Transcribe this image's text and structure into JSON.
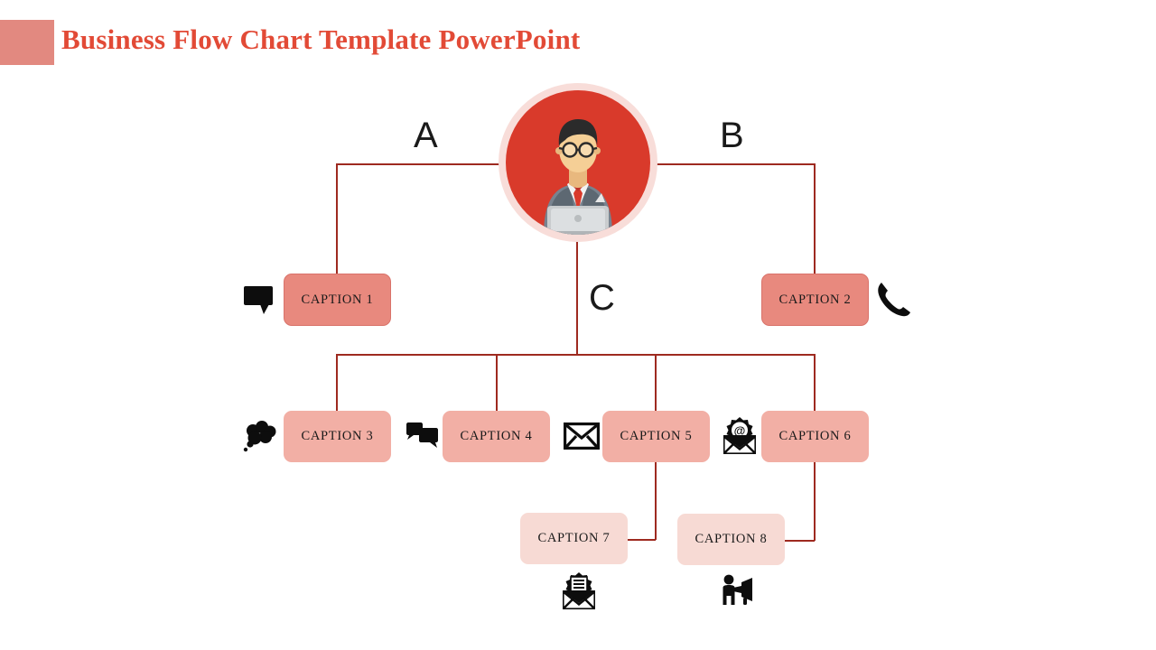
{
  "header": {
    "title": "Business Flow Chart Template PowerPoint",
    "swatch_color": "#e28980",
    "title_color": "#e24a36"
  },
  "theme": {
    "line_color": "#9e2a20",
    "box_dark": "#e8897e",
    "box_mid": "#f2afa5",
    "box_light": "#f7dad4",
    "avatar_ring": "#f8ddd9",
    "avatar_disc": "#d93a2b",
    "label_color": "#1a1a1a"
  },
  "avatar": {
    "name": "businessman-with-laptop-avatar",
    "description": "Illustrated businessman wearing glasses, gray suit and red tie working on a laptop"
  },
  "branch_labels": [
    {
      "id": "a",
      "text": "A"
    },
    {
      "id": "b",
      "text": "B"
    },
    {
      "id": "c",
      "text": "C"
    }
  ],
  "nodes": [
    {
      "id": "caption-1",
      "label": "CAPTION 1",
      "tone": "dark",
      "icon": "speech-bubble-icon",
      "icon_side": "left"
    },
    {
      "id": "caption-2",
      "label": "CAPTION 2",
      "tone": "dark",
      "icon": "phone-icon",
      "icon_side": "right"
    },
    {
      "id": "caption-3",
      "label": "CAPTION 3",
      "tone": "mid",
      "icon": "thought-bubble-icon",
      "icon_side": "left"
    },
    {
      "id": "caption-4",
      "label": "CAPTION 4",
      "tone": "mid",
      "icon": "chat-bubbles-icon",
      "icon_side": "left"
    },
    {
      "id": "caption-5",
      "label": "CAPTION 5",
      "tone": "mid",
      "icon": "envelope-icon",
      "icon_side": "left"
    },
    {
      "id": "caption-6",
      "label": "CAPTION 6",
      "tone": "mid",
      "icon": "email-at-envelope-icon",
      "icon_side": "left"
    },
    {
      "id": "caption-7",
      "label": "CAPTION 7",
      "tone": "light",
      "icon": "open-envelope-letter-icon",
      "icon_side": "below"
    },
    {
      "id": "caption-8",
      "label": "CAPTION 8",
      "tone": "light",
      "icon": "megaphone-person-icon",
      "icon_side": "below"
    }
  ]
}
